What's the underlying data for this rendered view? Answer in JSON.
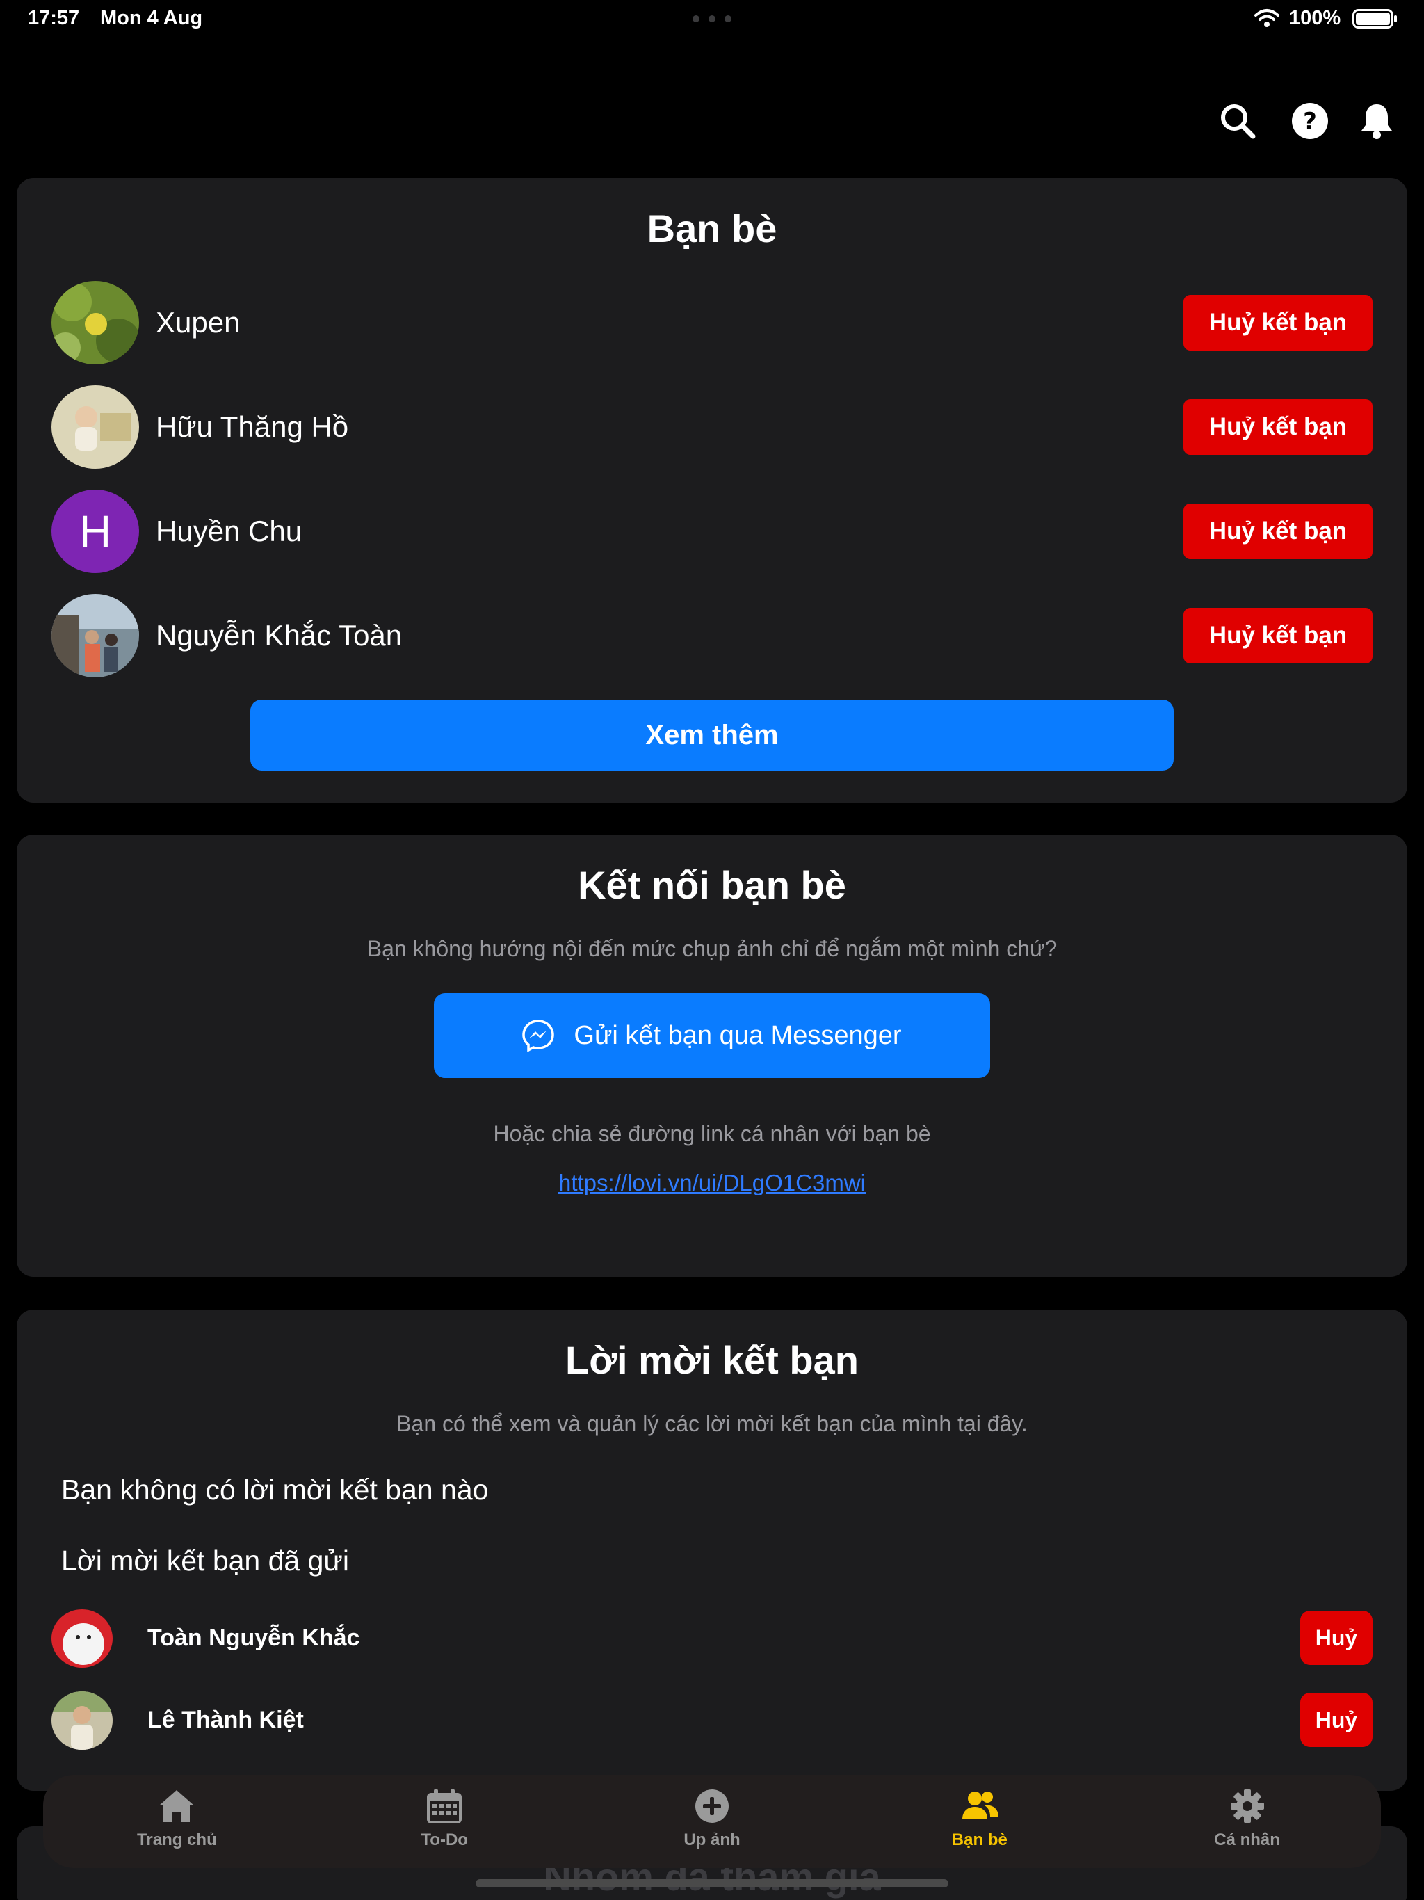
{
  "status_bar": {
    "time": "17:57",
    "date": "Mon 4 Aug",
    "battery": "100%"
  },
  "header": {
    "icons": [
      "search-icon",
      "help-icon",
      "bell-icon"
    ]
  },
  "friends_section": {
    "title": "Bạn bè",
    "friends": [
      {
        "name": "Xupen",
        "action": "Huỷ kết bạn"
      },
      {
        "name": "Hữu Thăng Hồ",
        "action": "Huỷ kết bạn"
      },
      {
        "name": "Huyền Chu",
        "initial": "H",
        "action": "Huỷ kết bạn"
      },
      {
        "name": "Nguyễn Khắc Toàn",
        "action": "Huỷ kết bạn"
      }
    ],
    "see_more": "Xem thêm"
  },
  "connect_section": {
    "title": "Kết nối bạn bè",
    "subtitle": "Bạn không hướng nội đến mức chụp ảnh chỉ để ngắm một mình chứ?",
    "messenger_button": "Gửi kết bạn qua Messenger",
    "share_text": "Hoặc chia sẻ đường link cá nhân với bạn bè",
    "link": "https://lovi.vn/ui/DLgO1C3mwi"
  },
  "invites_section": {
    "title": "Lời mời kết bạn",
    "subtitle": "Bạn có thể xem và quản lý các lời mời kết bạn của mình tại đây.",
    "empty_text": "Bạn không có lời mời kết bạn nào",
    "sent_heading": "Lời mời kết bạn đã gửi",
    "sent": [
      {
        "name": "Toàn Nguyễn Khắc",
        "action": "Huỷ"
      },
      {
        "name": "Lê Thành Kiệt",
        "action": "Huỷ"
      }
    ]
  },
  "groups_section": {
    "title": "Nhóm đã tham gia"
  },
  "tab_bar": {
    "tabs": [
      {
        "label": "Trang chủ",
        "icon": "home-icon"
      },
      {
        "label": "To-Do",
        "icon": "calendar-icon"
      },
      {
        "label": "Up ảnh",
        "icon": "plus-circle-icon"
      },
      {
        "label": "Bạn bè",
        "icon": "friends-icon",
        "active": true
      },
      {
        "label": "Cá nhân",
        "icon": "gear-icon"
      }
    ],
    "active_color": "#f7c400"
  },
  "colors": {
    "danger": "#e00000",
    "primary": "#0a7cff",
    "card": "#1c1c1e",
    "avatar_purple": "#7e25b3"
  }
}
